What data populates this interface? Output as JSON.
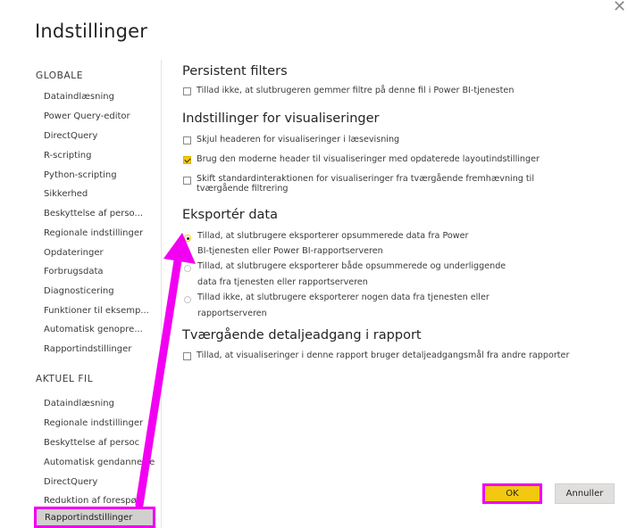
{
  "dialog": {
    "title": "Indstillinger",
    "close_symbol": "✕"
  },
  "sidebar": {
    "global_header": "GLOBALE",
    "global_items": [
      "Dataindlæsning",
      "Power Query-editor",
      "DirectQuery",
      "R-scripting",
      "Python-scripting",
      "Sikkerhed",
      "Beskyttelse af perso...",
      "Regionale indstillinger",
      "Opdateringer",
      "Forbrugsdata",
      "Diagnosticering",
      "Funktioner til eksemp...",
      "Automatisk genopre...",
      "Rapportindstillinger"
    ],
    "file_header": "AKTUEL FIL",
    "file_items": [
      "Dataindlæsning",
      "Regionale indstillinger",
      "Beskyttelse af persoc",
      "Automatisk gendannelse",
      "DirectQuery",
      "Reduktion af forespø..."
    ],
    "selected_item": "Rapportindstillinger"
  },
  "sections": {
    "persistent": {
      "title": "Persistent filters",
      "options": [
        {
          "label": "Tillad ikke, at slutbrugeren gemmer filtre på denne fil i Power BI-tjenesten",
          "checked": false
        }
      ]
    },
    "visual": {
      "title": "Indstillinger for visualiseringer",
      "options": [
        {
          "label": "Skjul headeren for visualiseringer i læsevisning",
          "checked": false
        },
        {
          "label": "Brug den moderne header til visualiseringer med opdaterede layoutindstillinger",
          "checked": true
        },
        {
          "label_line1": "Skift standardinteraktionen for visualiseringer fra tværgående fremhævning til",
          "label_line2": "tværgående filtrering",
          "checked": false
        }
      ]
    },
    "export": {
      "title": "Eksportér data",
      "options": [
        {
          "line1": "Tillad, at slutbrugere eksporterer opsummerede data fra Power",
          "line2": "BI-tjenesten eller Power BI-rapportserveren",
          "selected": true
        },
        {
          "line1": "Tillad, at slutbrugere eksporterer både opsummerede og underliggende",
          "line2": "data fra tjenesten eller rapportserveren",
          "selected": false
        },
        {
          "line1": "Tillad ikke, at slutbrugere eksporterer nogen data fra tjenesten eller",
          "line2": "rapportserveren",
          "selected": false
        }
      ]
    },
    "drillthrough": {
      "title": "Tværgående detaljeadgang i rapport",
      "options": [
        {
          "label": "Tillad, at visualiseringer i denne rapport bruger detaljeadgangsmål fra andre rapporter",
          "checked": false
        }
      ]
    }
  },
  "buttons": {
    "ok": "OK",
    "cancel": "Annuller"
  },
  "colors": {
    "accent_yellow": "#f2c811",
    "annotation_magenta": "#f200f2",
    "selected_bg": "#d2d0ce"
  }
}
